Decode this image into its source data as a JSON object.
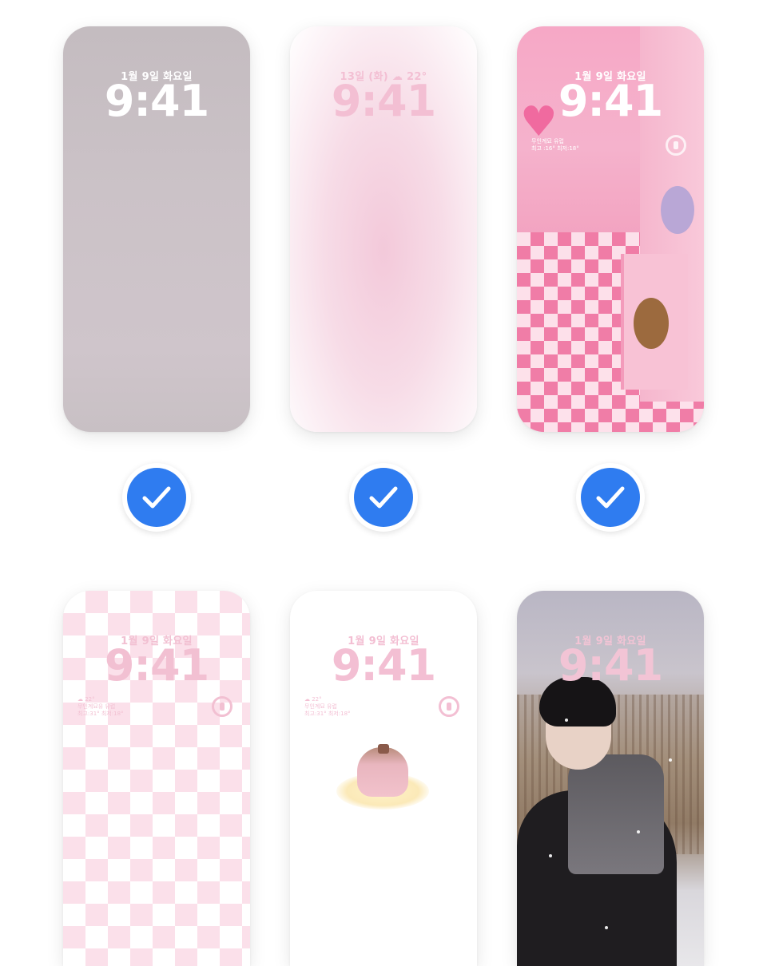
{
  "colors": {
    "accent": "#2f7cf0",
    "time_white": "#ffffff",
    "time_pink": "#f3bfd3",
    "time_light_pink": "#f6cfdc"
  },
  "wallpapers": [
    {
      "date": "1월 9일 화요일",
      "time": "9:41",
      "selected": true
    },
    {
      "date": "13일 (화)  ☁ 22°",
      "time": "9:41",
      "selected": true
    },
    {
      "date": "1월 9일 화요일",
      "time": "9:41",
      "selected": true,
      "widget_lines": [
        "무인계묘 유럽",
        "최고 :16° 최저:18°"
      ]
    },
    {
      "date": "1월 9일 화요일",
      "time": "9:41",
      "selected": false,
      "widget_lines": [
        "☁ 22°",
        "무인계묘유 유럽",
        "최고:31° 최저:18°"
      ]
    },
    {
      "date": "1월 9일 화요일",
      "time": "9:41",
      "selected": false,
      "widget_lines": [
        "☁ 22°",
        "무인계묘 유럽",
        "최고:31° 최저:18°"
      ]
    },
    {
      "date": "1월 9일 화요일",
      "time": "9:41",
      "selected": false
    }
  ],
  "icons": {
    "check": "checkmark-icon",
    "ring": "activity-ring-icon",
    "heart": "heart-icon"
  }
}
